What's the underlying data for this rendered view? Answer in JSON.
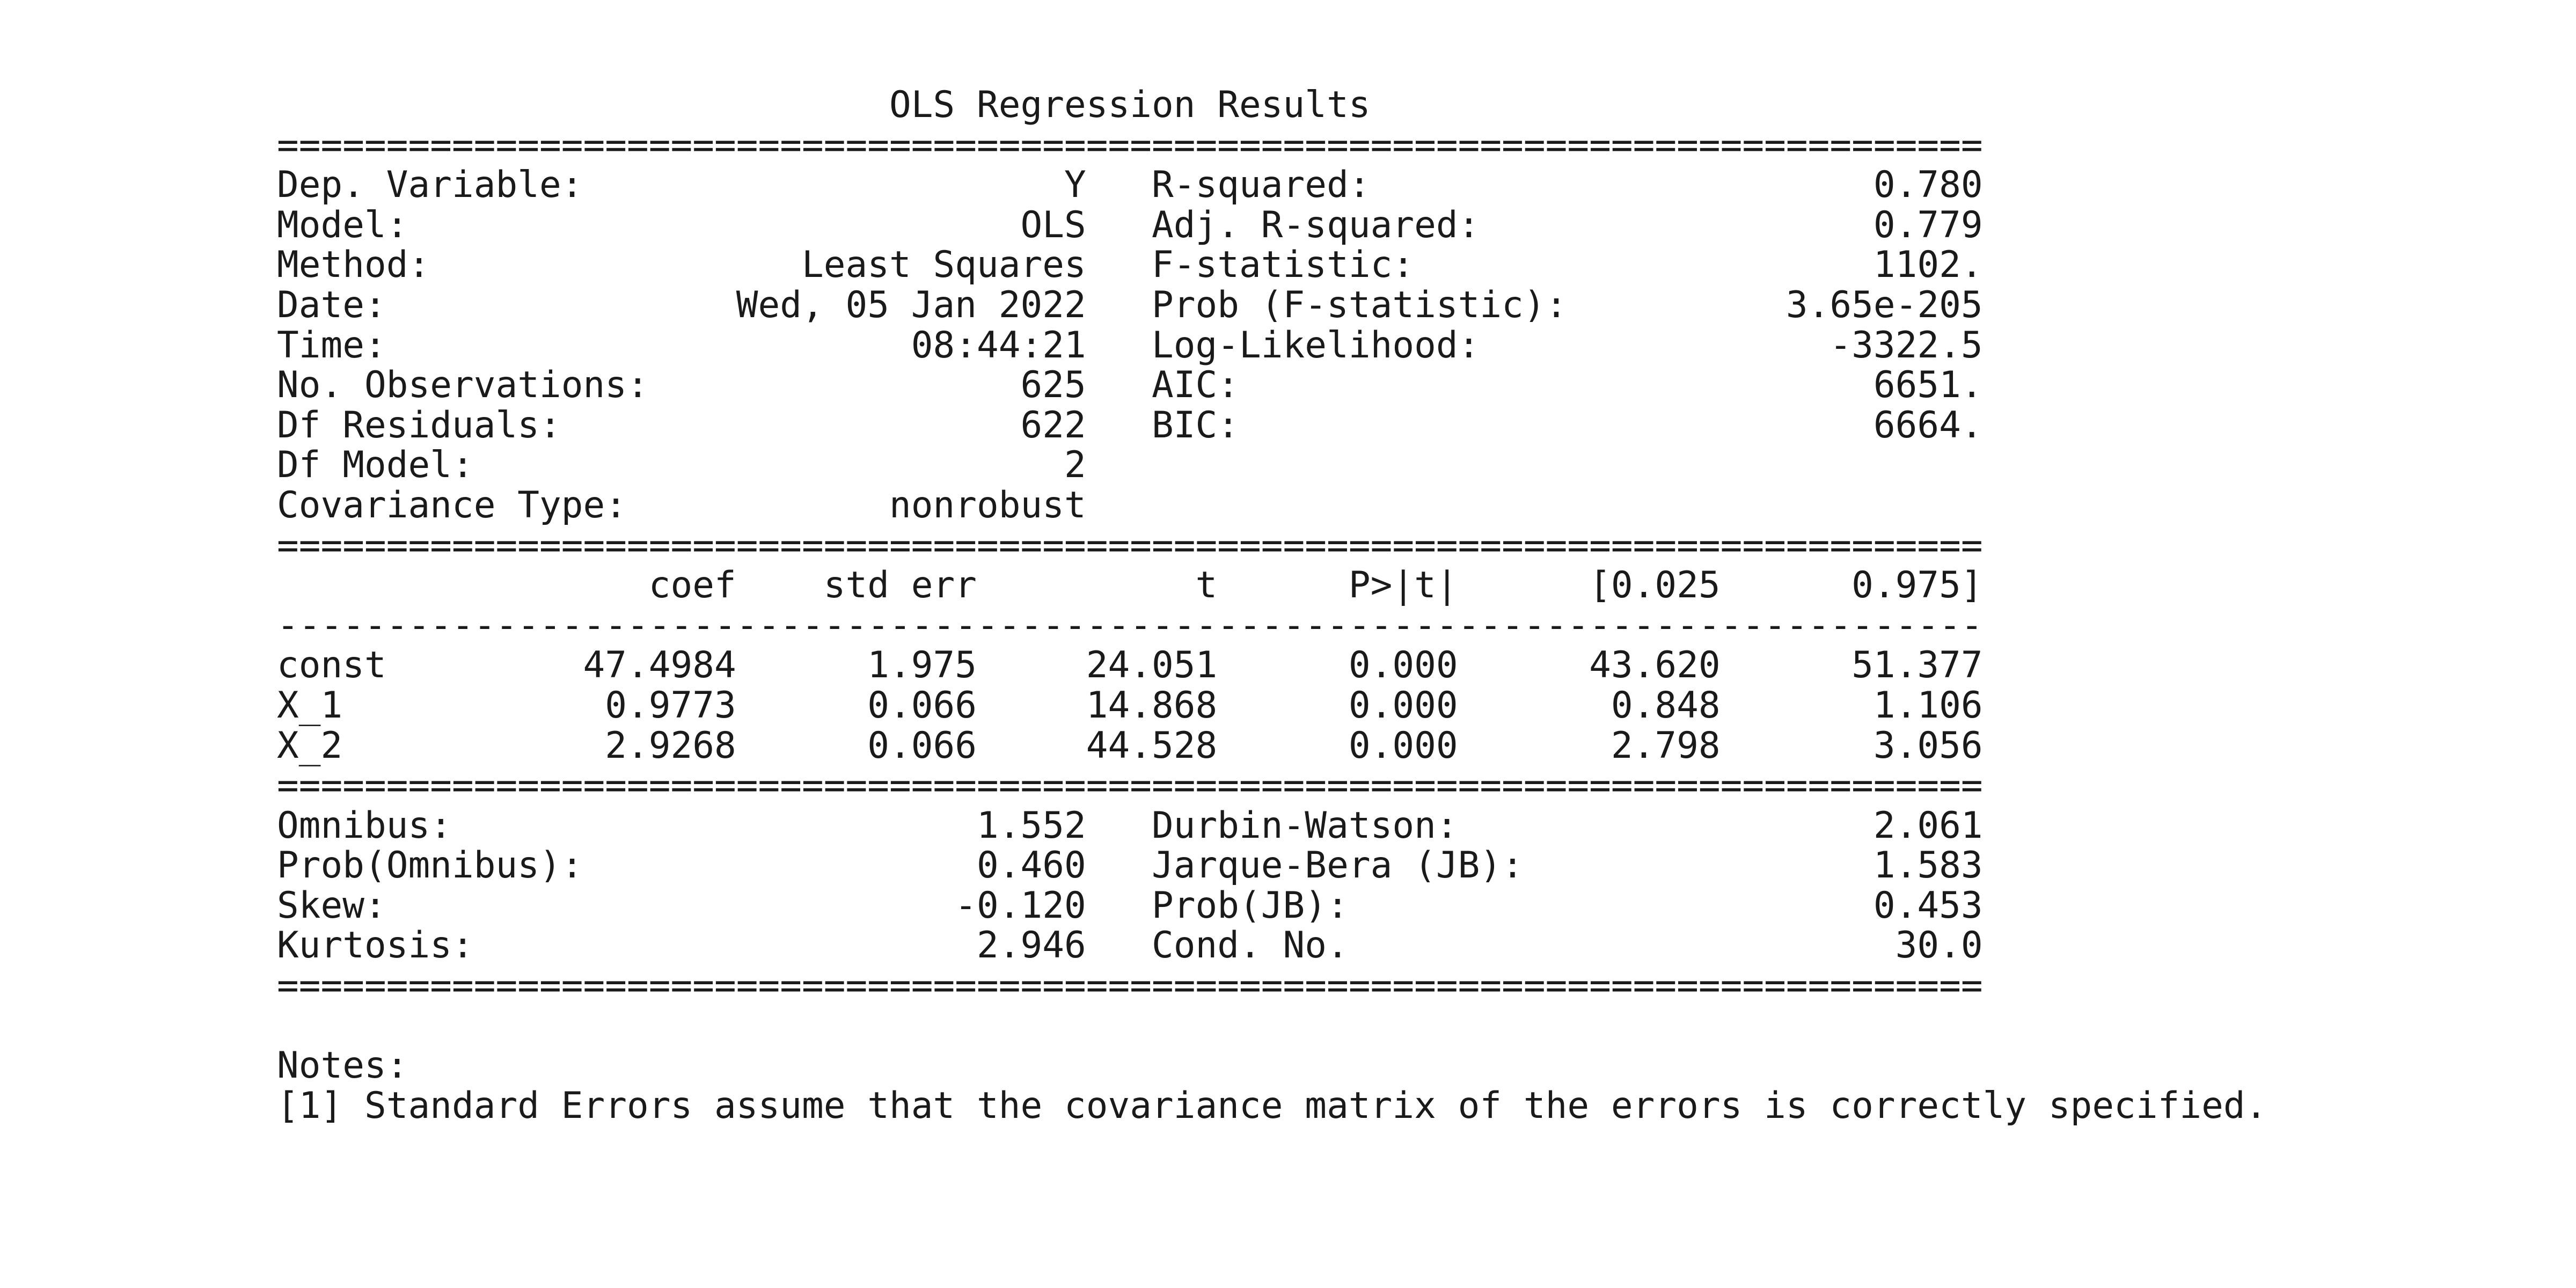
{
  "document": {
    "title": "OLS Regression Results",
    "separator_major": "==============================================================================",
    "separator_minor": "------------------------------------------------------------------------------",
    "model_info": [
      {
        "left_label": "Dep. Variable:",
        "left_value": "Y",
        "right_label": "R-squared:",
        "right_value": "0.780"
      },
      {
        "left_label": "Model:",
        "left_value": "OLS",
        "right_label": "Adj. R-squared:",
        "right_value": "0.779"
      },
      {
        "left_label": "Method:",
        "left_value": "Least Squares",
        "right_label": "F-statistic:",
        "right_value": "1102."
      },
      {
        "left_label": "Date:",
        "left_value": "Wed, 05 Jan 2022",
        "right_label": "Prob (F-statistic):",
        "right_value": "3.65e-205"
      },
      {
        "left_label": "Time:",
        "left_value": "08:44:21",
        "right_label": "Log-Likelihood:",
        "right_value": "-3322.5"
      },
      {
        "left_label": "No. Observations:",
        "left_value": "625",
        "right_label": "AIC:",
        "right_value": "6651."
      },
      {
        "left_label": "Df Residuals:",
        "left_value": "622",
        "right_label": "BIC:",
        "right_value": "6664."
      },
      {
        "left_label": "Df Model:",
        "left_value": "2",
        "right_label": "",
        "right_value": ""
      },
      {
        "left_label": "Covariance Type:",
        "left_value": "nonrobust",
        "right_label": "",
        "right_value": ""
      }
    ],
    "coef_headers": [
      "",
      "coef",
      "std err",
      "t",
      "P>|t|",
      "[0.025",
      "0.975]"
    ],
    "coef_rows": [
      [
        "const",
        "47.4984",
        "1.975",
        "24.051",
        "0.000",
        "43.620",
        "51.377"
      ],
      [
        "X_1",
        "0.9773",
        "0.066",
        "14.868",
        "0.000",
        "0.848",
        "1.106"
      ],
      [
        "X_2",
        "2.9268",
        "0.066",
        "44.528",
        "0.000",
        "2.798",
        "3.056"
      ]
    ],
    "diagnostics": [
      {
        "left_label": "Omnibus:",
        "left_value": "1.552",
        "right_label": "Durbin-Watson:",
        "right_value": "2.061"
      },
      {
        "left_label": "Prob(Omnibus):",
        "left_value": "0.460",
        "right_label": "Jarque-Bera (JB):",
        "right_value": "1.583"
      },
      {
        "left_label": "Skew:",
        "left_value": "-0.120",
        "right_label": "Prob(JB):",
        "right_value": "0.453"
      },
      {
        "left_label": "Kurtosis:",
        "left_value": "2.946",
        "right_label": "Cond. No.",
        "right_value": "30.0"
      }
    ],
    "notes_heading": "Notes:",
    "notes": [
      "[1] Standard Errors assume that the covariance matrix of the errors is correctly specified."
    ]
  }
}
